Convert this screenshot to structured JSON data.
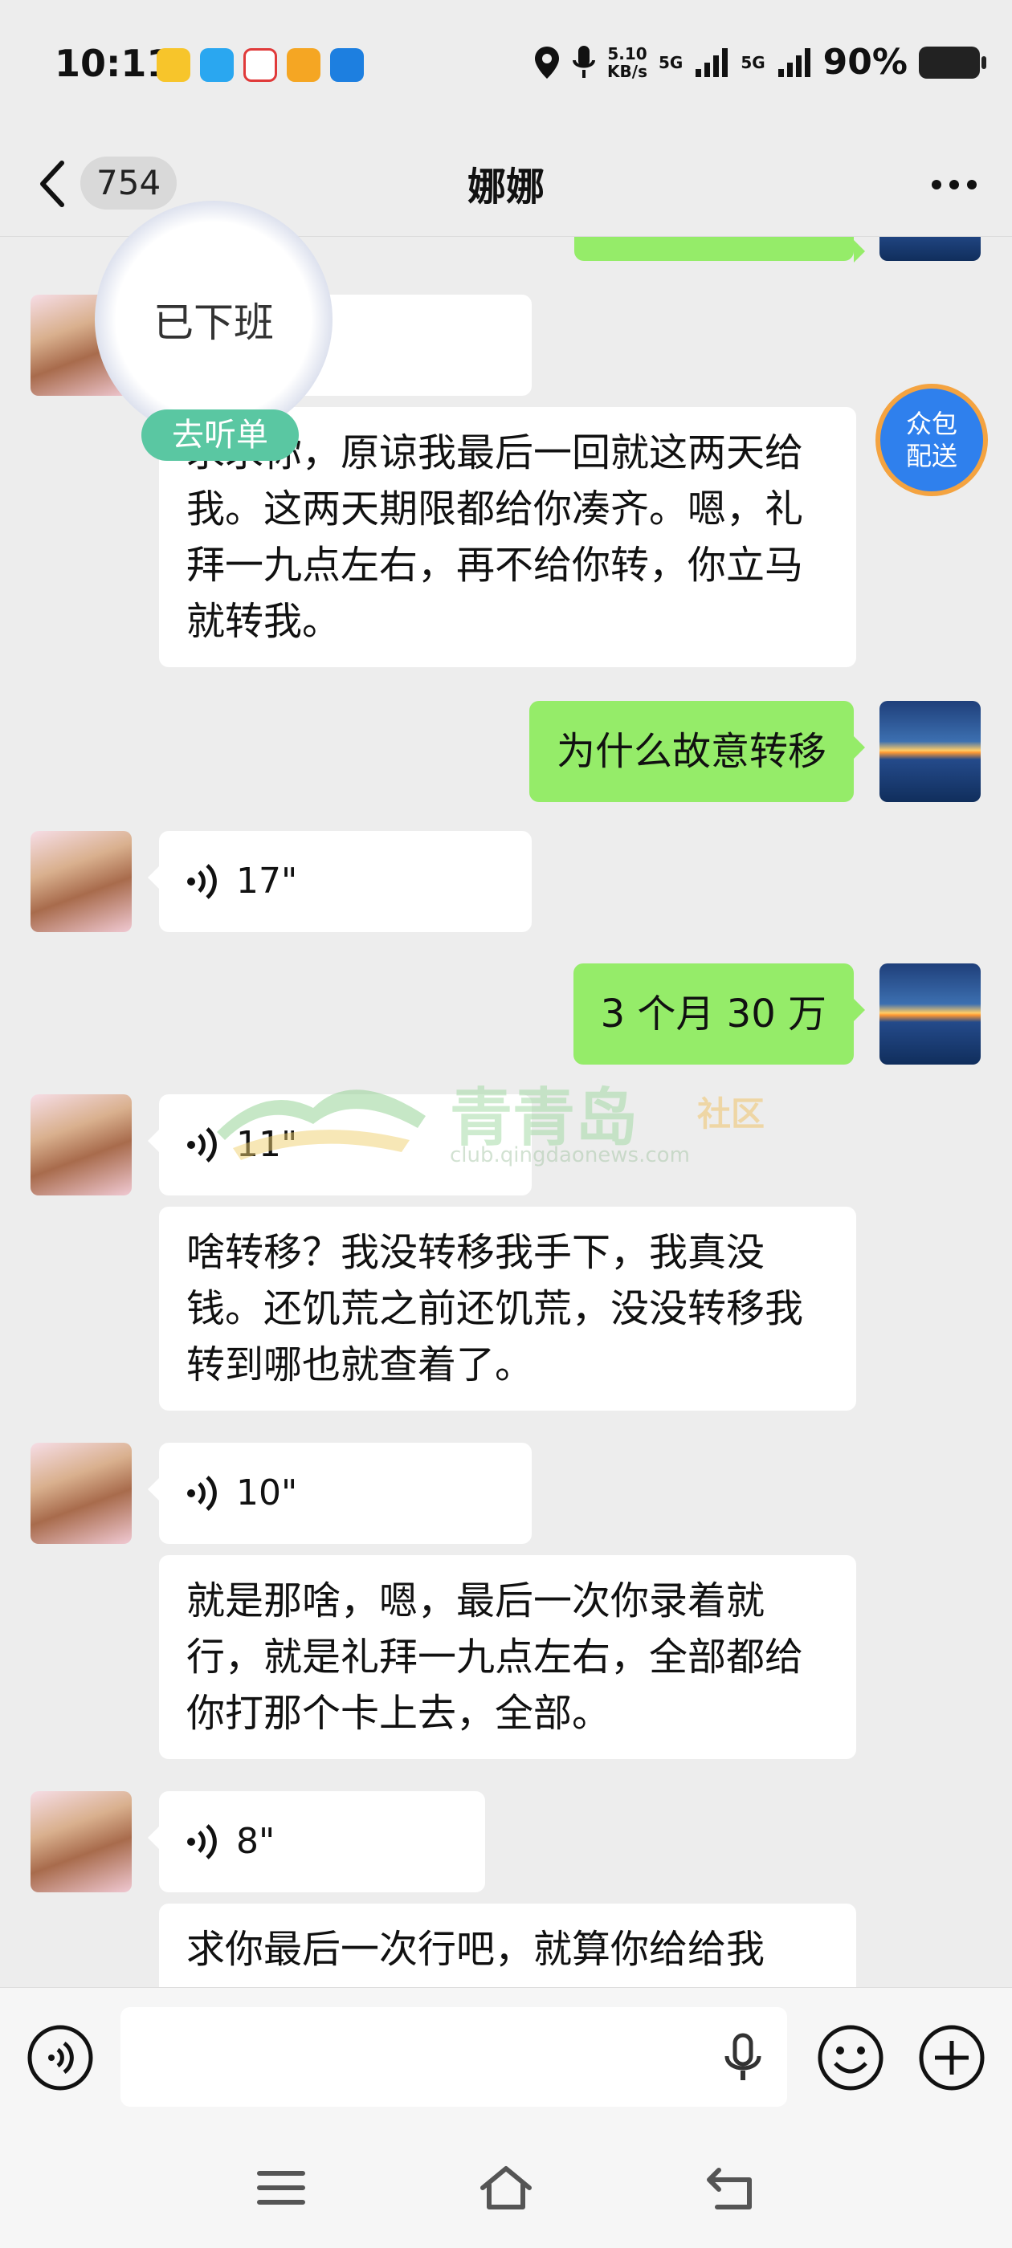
{
  "status_bar": {
    "time": "10:11",
    "net_speed_value": "5.10",
    "net_speed_unit": "KB/s",
    "sim1": "5G",
    "sim2": "5G",
    "battery": "90%",
    "app_icons": [
      "app-icon-yellow",
      "app-icon-cloud",
      "app-icon-check",
      "weibo-icon",
      "app-icon-blue"
    ]
  },
  "nav": {
    "unread_count": "754",
    "title": "娜娜"
  },
  "overlays": {
    "float_circle_text": "已下班",
    "float_tag": "去听单",
    "delivery_badge_line1": "众包",
    "delivery_badge_line2": "配送"
  },
  "messages": {
    "m1": "求求你，原谅我最后一回就这两天给我。这两天期限都给你凑齐。嗯，礼拜一九点左右，再不给你转，你立马就转我。",
    "m2": "为什么故意转移",
    "m3_voice": "17\"",
    "m4": "3 个月 30 万",
    "m5_voice": "11\"",
    "m6": "啥转移？我没转移我手下，我真没钱。还饥荒之前还饥荒，没没转移我转到哪也就查着了。",
    "m7_voice": "10\"",
    "m8": "就是那啥，嗯，最后一次你录着就行，就是礼拜一九点左右，全部都给你打那个卡上去，全部。",
    "m9_voice": "8\"",
    "m10": "求你最后一次行吧，就算你给给我"
  },
  "watermark": {
    "name": "青青岛",
    "tag": "社区",
    "url": "club.qingdaonews.com"
  },
  "colors": {
    "chat_background": "#ededed",
    "outgoing_bubble": "#95ec69",
    "incoming_bubble": "#ffffff",
    "float_tag": "#5ac7a2",
    "delivery_badge": "#2f80ed"
  }
}
